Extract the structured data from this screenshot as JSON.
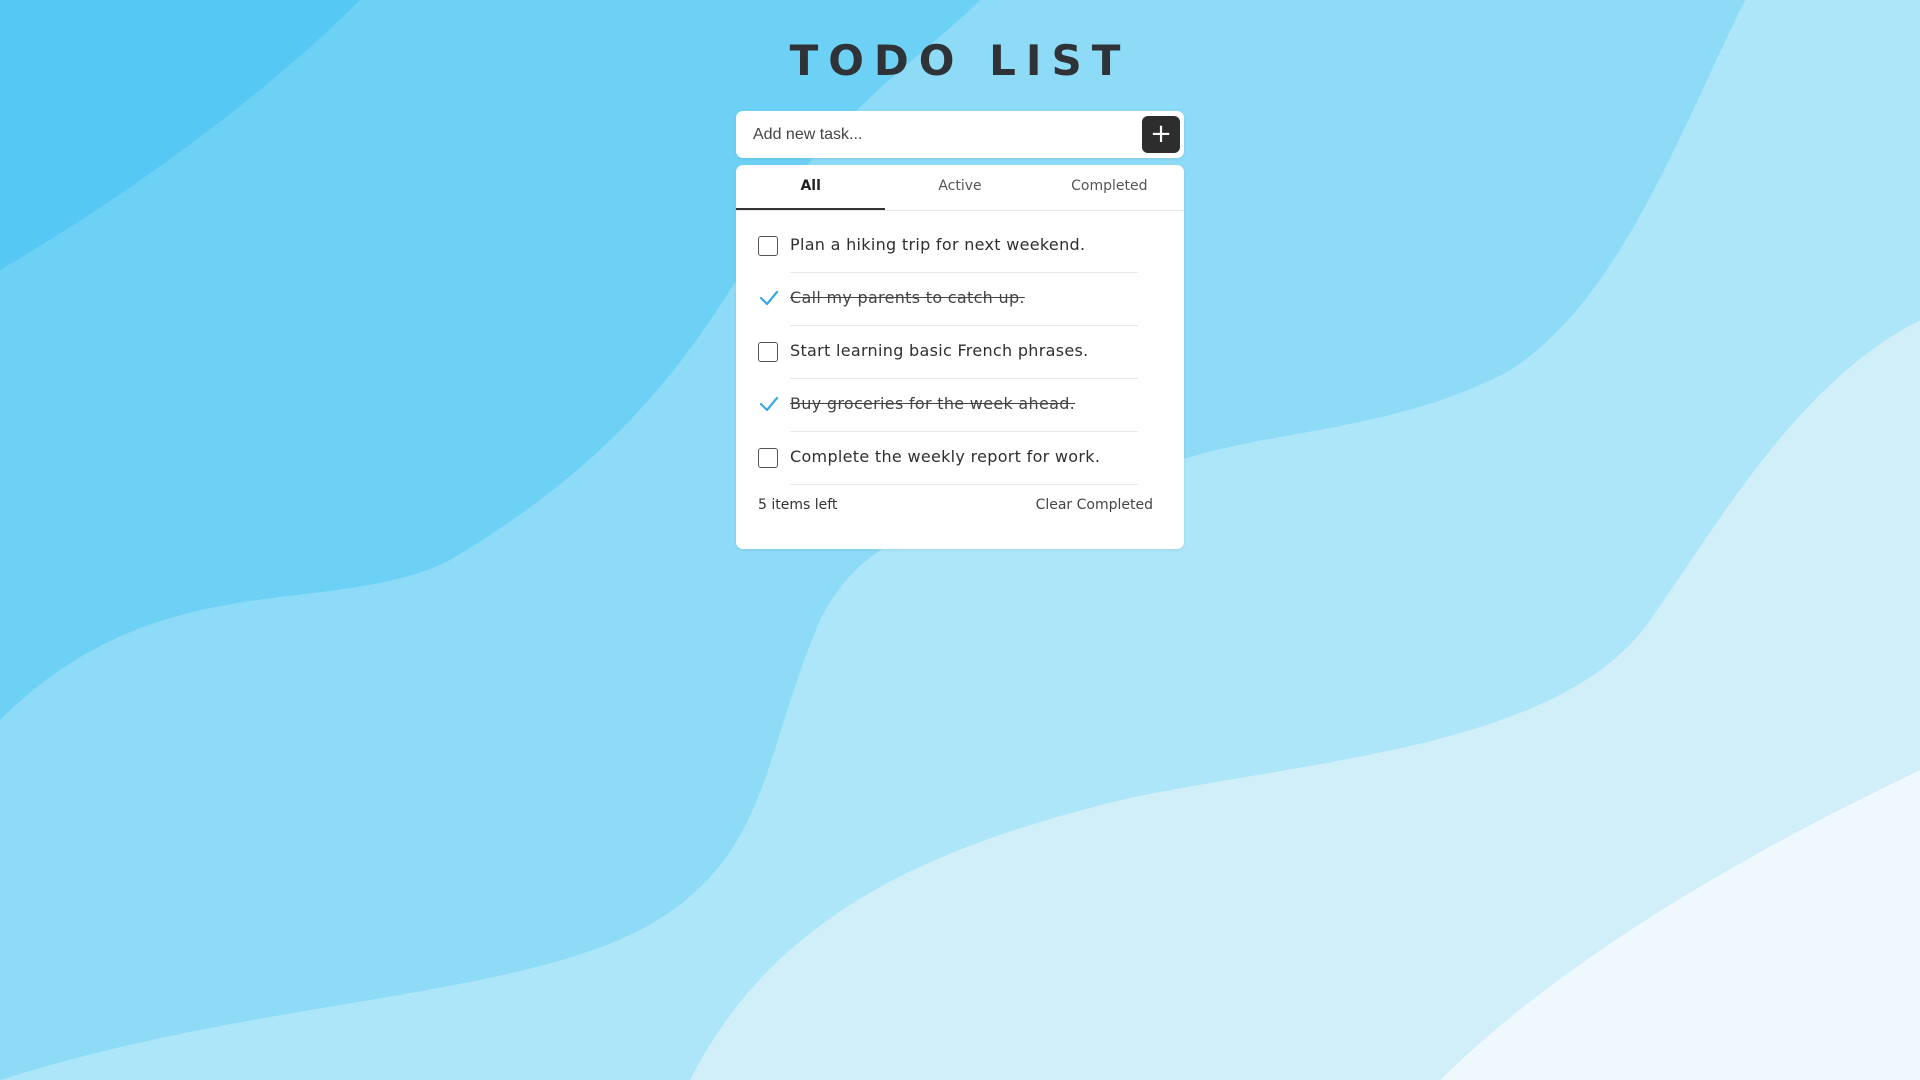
{
  "app": {
    "title": "TODO LIST"
  },
  "add_task": {
    "placeholder": "Add new task...",
    "value": "",
    "button_label": "+"
  },
  "tabs": [
    {
      "label": "All",
      "active": true
    },
    {
      "label": "Active",
      "active": false
    },
    {
      "label": "Completed",
      "active": false
    }
  ],
  "tasks": [
    {
      "text": "Plan a hiking trip for next weekend.",
      "completed": false
    },
    {
      "text": "Call my parents to catch up.",
      "completed": true
    },
    {
      "text": "Start learning basic French phrases.",
      "completed": false
    },
    {
      "text": "Buy groceries for the week ahead.",
      "completed": true
    },
    {
      "text": "Complete the weekly report for work.",
      "completed": false
    }
  ],
  "footer": {
    "items_left": "5 items left",
    "clear_label": "Clear Completed"
  },
  "colors": {
    "accent_check": "#3aa8e0",
    "button_dark": "#2d2d2d",
    "title": "#2f3338"
  },
  "icons": {
    "add": "plus-icon",
    "done": "checkmark-icon",
    "todo": "checkbox-empty"
  }
}
